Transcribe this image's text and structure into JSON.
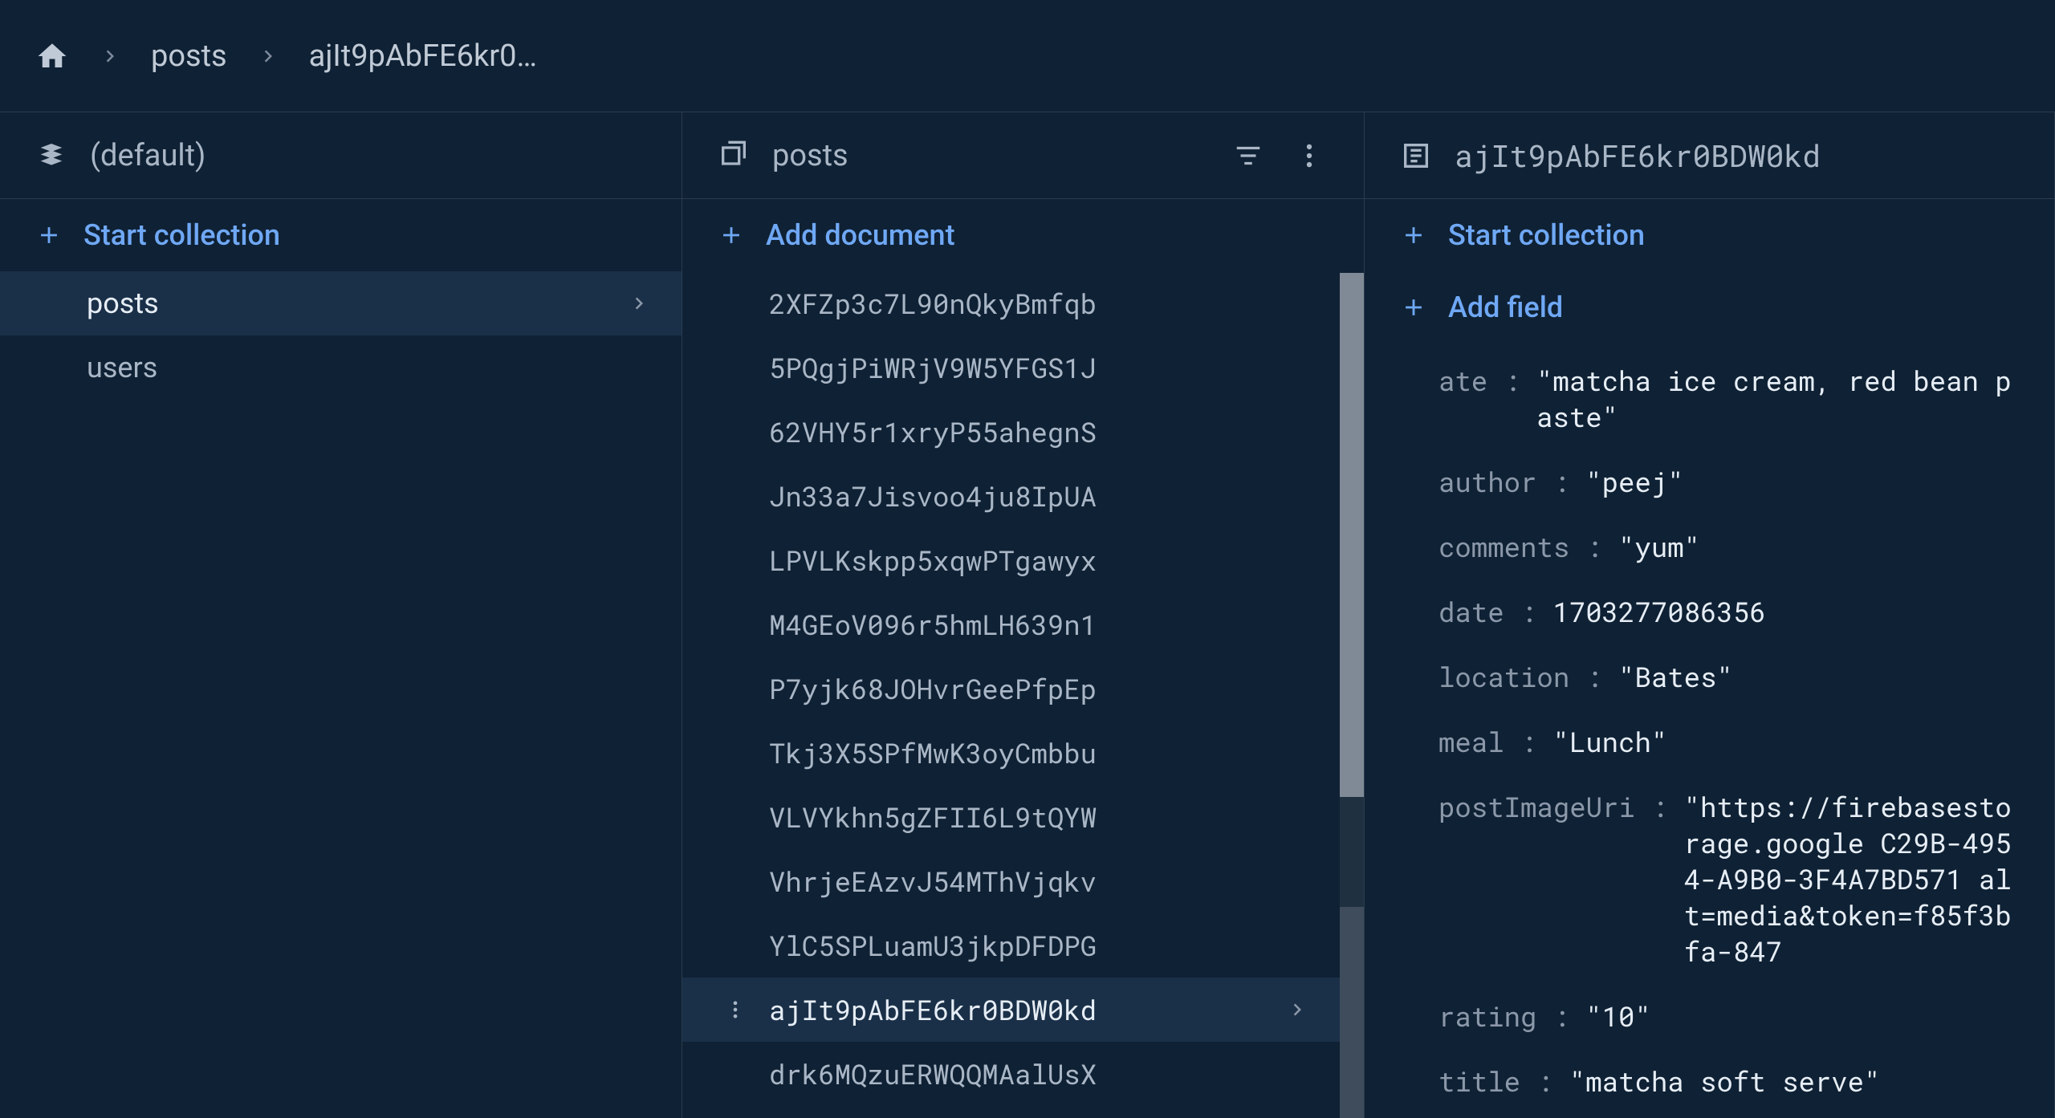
{
  "breadcrumb": {
    "collection": "posts",
    "docShort": "ajIt9pAbFE6kr0…"
  },
  "rootPanel": {
    "headerLabel": "(default)",
    "startCollectionLabel": "Start collection",
    "collections": [
      {
        "name": "posts",
        "selected": true
      },
      {
        "name": "users",
        "selected": false
      }
    ]
  },
  "docsPanel": {
    "headerLabel": "posts",
    "addDocumentLabel": "Add document",
    "selectedId": "ajIt9pAbFE6kr0BDW0kd",
    "documents": [
      "2XFZp3c7L90nQkyBmfqb",
      "5PQgjPiWRjV9W5YFGS1J",
      "62VHY5r1xryP55ahegnS",
      "Jn33a7Jisvoo4ju8IpUA",
      "LPVLKskpp5xqwPTgawyx",
      "M4GEoV096r5hmLH639n1",
      "P7yjk68JOHvrGeePfpEp",
      "Tkj3X5SPfMwK3oyCmbbu",
      "VLVYkhn5gZFII6L9tQYW",
      "VhrjeEAzvJ54MThVjqkv",
      "YlC5SPLuamU3jkpDFDPG",
      "ajIt9pAbFE6kr0BDW0kd",
      "drk6MQzuERWQQMAalUsX"
    ]
  },
  "docPanel": {
    "headerLabel": "ajIt9pAbFE6kr0BDW0kd",
    "startCollectionLabel": "Start collection",
    "addFieldLabel": "Add field",
    "fields": [
      {
        "key": "ate",
        "value": "\"matcha ice cream, red bean paste\""
      },
      {
        "key": "author",
        "value": "\"peej\""
      },
      {
        "key": "comments",
        "value": "\"yum\""
      },
      {
        "key": "date",
        "value": "1703277086356"
      },
      {
        "key": "location",
        "value": "\"Bates\""
      },
      {
        "key": "meal",
        "value": "\"Lunch\""
      },
      {
        "key": "postImageUri",
        "value": "\"https://firebasestorage.google C29B-4954-A9B0-3F4A7BD571 alt=media&token=f85f3bfa-847"
      },
      {
        "key": "rating",
        "value": "\"10\""
      },
      {
        "key": "title",
        "value": "\"matcha soft serve\""
      }
    ]
  }
}
